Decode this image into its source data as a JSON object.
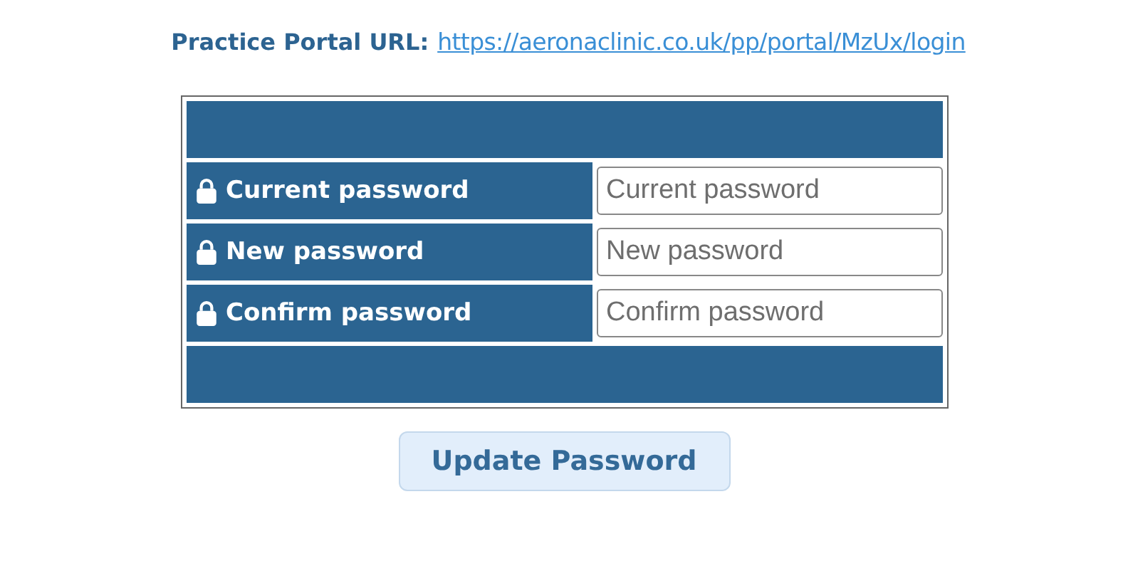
{
  "portal": {
    "label": "Practice Portal URL:",
    "url": "https://aeronaclinic.co.uk/pp/portal/MzUx/login"
  },
  "fields": [
    {
      "label": "Current password",
      "placeholder": "Current password"
    },
    {
      "label": "New password",
      "placeholder": "New password"
    },
    {
      "label": "Confirm password",
      "placeholder": "Confirm password"
    }
  ],
  "button": "Update Password"
}
